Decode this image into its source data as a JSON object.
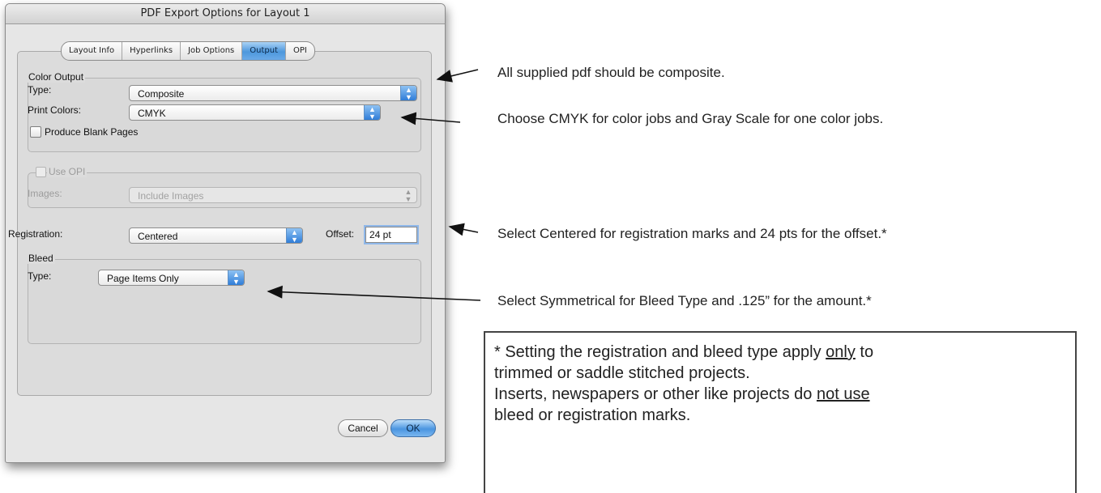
{
  "dialog": {
    "title": "PDF Export Options for Layout 1",
    "tabs": [
      "Layout Info",
      "Hyperlinks",
      "Job Options",
      "Output",
      "OPI"
    ],
    "active_tab": "Output",
    "color_output": {
      "group_label": "Color Output",
      "type_label": "Type:",
      "type_value": "Composite",
      "print_colors_label": "Print Colors:",
      "print_colors_value": "CMYK",
      "blank_pages_label": "Produce Blank Pages"
    },
    "opi": {
      "use_opi_label": "Use OPI",
      "images_label": "Images:",
      "images_value": "Include Images"
    },
    "registration": {
      "label": "Registration:",
      "value": "Centered",
      "offset_label": "Offset:",
      "offset_value": "24 pt"
    },
    "bleed": {
      "group_label": "Bleed",
      "type_label": "Type:",
      "type_value": "Page Items Only"
    },
    "buttons": {
      "cancel": "Cancel",
      "ok": "OK"
    }
  },
  "annotations": {
    "note1": "All supplied pdf should be composite.",
    "note2": "Choose CMYK for color jobs and Gray Scale for one color jobs.",
    "note3": "Select Centered for registration marks and 24 pts for the offset.*",
    "note4": "Select Symmetrical for Bleed Type and .125” for the amount.*",
    "box": {
      "line1_a": "* Setting the registration and bleed type apply ",
      "line1_u": "only",
      "line1_b": " to",
      "line2": "trimmed or saddle stitched projects.",
      "line3_a": "Inserts, newspapers or other like projects do ",
      "line3_u": "not use",
      "line4": "bleed or registration marks."
    }
  },
  "colors": {
    "accent_blue": "#4d97dc",
    "dialog_bg": "#e6e6e6",
    "text": "#222222"
  }
}
